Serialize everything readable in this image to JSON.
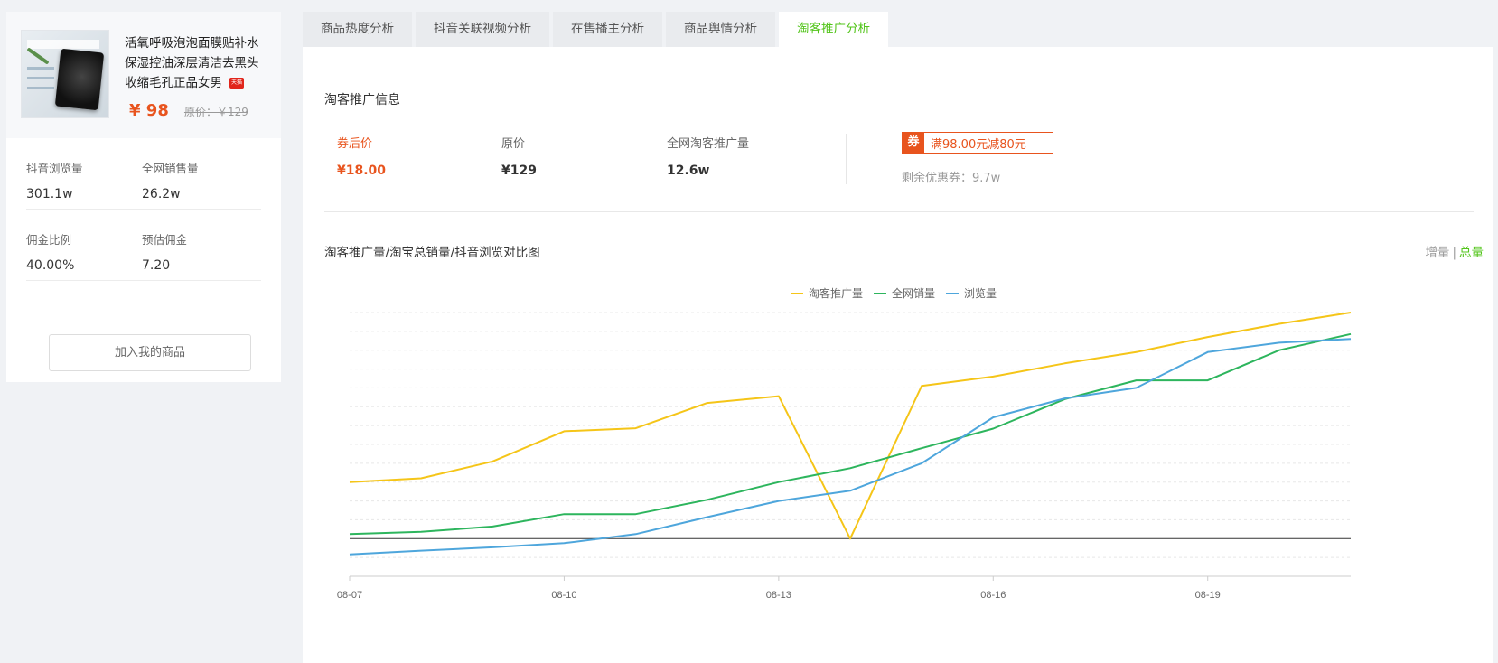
{
  "product": {
    "image_icon": "face-mask-product-image",
    "title": "活氧呼吸泡泡面膜贴补水保湿控油深层清洁去黑头收缩毛孔正品女男",
    "badge": "天猫",
    "price": "¥ 98",
    "original_price": "原价：￥129",
    "stats": [
      [
        {
          "label": "抖音浏览量",
          "value": "301.1w"
        },
        {
          "label": "全网销售量",
          "value": "26.2w"
        }
      ],
      [
        {
          "label": "佣金比例",
          "value": "40.00%"
        },
        {
          "label": "预估佣金",
          "value": "7.20"
        }
      ]
    ],
    "add_button": "加入我的商品"
  },
  "tabs": [
    {
      "label": "商品热度分析",
      "active": false
    },
    {
      "label": "抖音关联视频分析",
      "active": false
    },
    {
      "label": "在售播主分析",
      "active": false
    },
    {
      "label": "商品舆情分析",
      "active": false
    },
    {
      "label": "淘客推广分析",
      "active": true
    }
  ],
  "promo": {
    "section_title": "淘客推广信息",
    "items": [
      {
        "label": "券后价",
        "value": "¥18.00",
        "accent": true
      },
      {
        "label": "原价",
        "value": "¥129",
        "accent": false
      },
      {
        "label": "全网淘客推广量",
        "value": "12.6w",
        "accent": false
      }
    ],
    "coupon_tag": "券",
    "coupon_text": "满98.00元减80元",
    "coupon_remaining": "剩余优惠券：9.7w"
  },
  "chart_header": {
    "title": "淘客推广量/淘宝总销量/抖音浏览对比图",
    "toggle_increment": "增量",
    "toggle_separator": "|",
    "toggle_total": "总量"
  },
  "colors": {
    "accent": "#e8541e",
    "green": "#52c41a"
  },
  "chart_data": {
    "type": "line",
    "x": [
      "08-07",
      "08-08",
      "08-09",
      "08-10",
      "08-11",
      "08-12",
      "08-13",
      "08-14",
      "08-15",
      "08-16",
      "08-17",
      "08-18",
      "08-19",
      "08-20",
      "08-21"
    ],
    "tick_labels": [
      "08-07",
      "08-10",
      "08-13",
      "08-16",
      "08-19"
    ],
    "ylim": [
      -1,
      6
    ],
    "zero_line": 0,
    "grid": "dashed-horizontal",
    "legend": "top-center",
    "series": [
      {
        "name": "淘客推广量",
        "color": "#f5c518",
        "values": [
          1.5,
          1.6,
          2.05,
          2.85,
          2.93,
          3.6,
          3.78,
          0,
          4.05,
          4.3,
          4.65,
          4.95,
          5.35,
          5.7,
          6.0
        ]
      },
      {
        "name": "全网销量",
        "color": "#2db55d",
        "values": [
          0.12,
          0.18,
          0.32,
          0.65,
          0.65,
          1.03,
          1.5,
          1.87,
          2.4,
          2.92,
          3.7,
          4.2,
          4.2,
          5.0,
          5.43
        ]
      },
      {
        "name": "浏览量",
        "color": "#4ea6dc",
        "values": [
          -0.42,
          -0.32,
          -0.23,
          -0.12,
          0.12,
          0.57,
          1.0,
          1.27,
          2.0,
          3.22,
          3.72,
          4.0,
          4.95,
          5.2,
          5.3
        ]
      }
    ]
  }
}
